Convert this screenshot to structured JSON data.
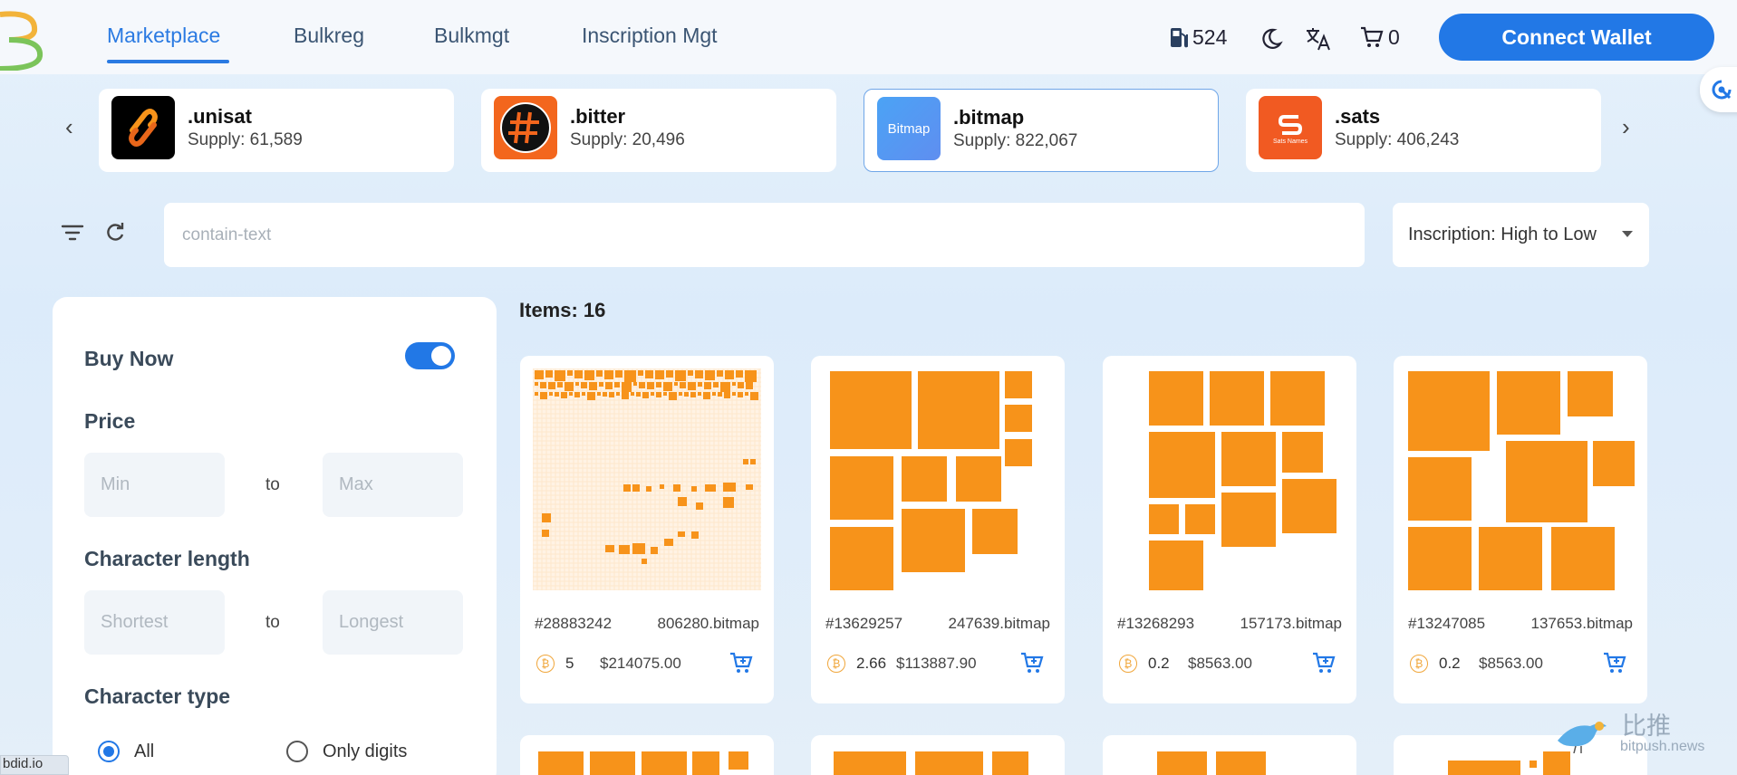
{
  "header": {
    "nav": [
      {
        "label": "Marketplace",
        "active": true
      },
      {
        "label": "Bulkreg",
        "active": false
      },
      {
        "label": "Bulkmgt",
        "active": false
      },
      {
        "label": "Inscription Mgt",
        "active": false
      }
    ],
    "gas_icon": "gas-pump-icon",
    "gas_value": "524",
    "theme_icon": "moon-icon",
    "language_icon": "translate-icon",
    "cart_icon": "cart-icon",
    "cart_count": "0",
    "connect_label": "Connect Wallet"
  },
  "collections": [
    {
      "name": ".unisat",
      "supply": "Supply: 61,589",
      "selected": false,
      "icon": "unisat-logo"
    },
    {
      "name": ".bitter",
      "supply": "Supply: 20,496",
      "selected": false,
      "icon": "bitter-logo"
    },
    {
      "name": ".bitmap",
      "supply": "Supply: 822,067",
      "selected": true,
      "icon": "bitmap-logo",
      "icon_text": "Bitmap"
    },
    {
      "name": ".sats",
      "supply": "Supply: 406,243",
      "selected": false,
      "icon": "sats-logo",
      "icon_text": "Sats Names"
    }
  ],
  "search": {
    "placeholder": "contain-text",
    "value": ""
  },
  "sort": {
    "selected": "Inscription: High to Low"
  },
  "filters": {
    "buy_now_label": "Buy Now",
    "buy_now_on": true,
    "price_label": "Price",
    "price_min_placeholder": "Min",
    "price_max_placeholder": "Max",
    "to_label": "to",
    "length_label": "Character length",
    "length_min_placeholder": "Shortest",
    "length_max_placeholder": "Longest",
    "type_label": "Character type",
    "type_options": [
      {
        "label": "All",
        "checked": true
      },
      {
        "label": "Only digits",
        "checked": false
      }
    ]
  },
  "items_count": "Items: 16",
  "items": [
    {
      "inscription": "#28883242",
      "name": "806280.bitmap",
      "price": "5",
      "usd": "$214075.00"
    },
    {
      "inscription": "#13629257",
      "name": "247639.bitmap",
      "price": "2.66",
      "usd": "$113887.90"
    },
    {
      "inscription": "#13268293",
      "name": "157173.bitmap",
      "price": "0.2",
      "usd": "$8563.00"
    },
    {
      "inscription": "#13247085",
      "name": "137653.bitmap",
      "price": "0.2",
      "usd": "$8563.00"
    }
  ],
  "colors": {
    "accent": "#2278e6",
    "block_orange": "#f7931a",
    "btc": "#f0a63a"
  },
  "status_url": "bdid.io",
  "watermark": {
    "cn": "比推",
    "en": "bitpush.news"
  }
}
